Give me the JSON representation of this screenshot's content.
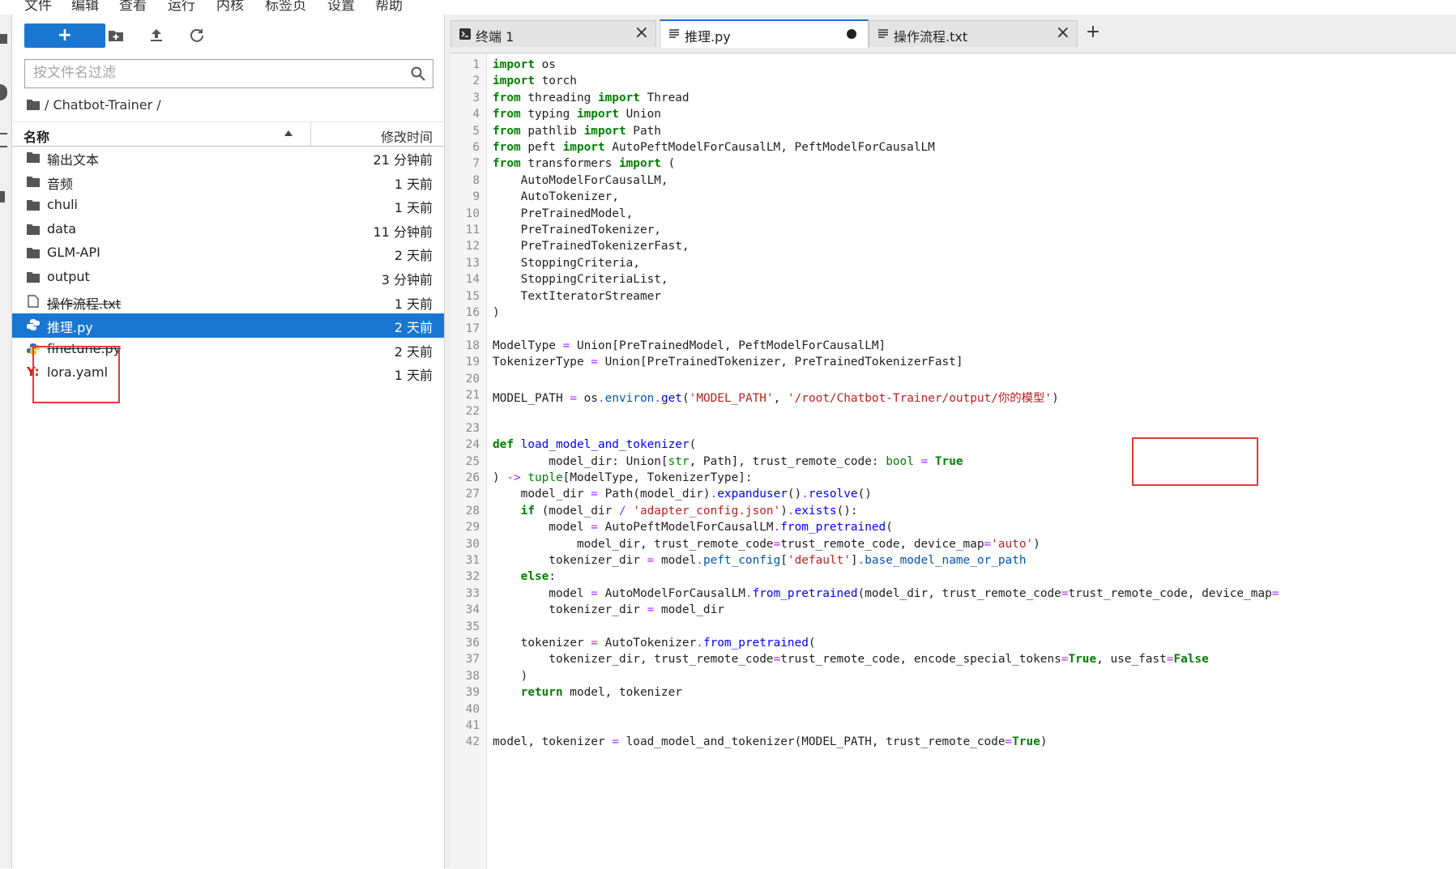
{
  "menu": {
    "items": [
      "文件",
      "编辑",
      "查看",
      "运行",
      "内核",
      "标签页",
      "设置",
      "帮助"
    ]
  },
  "file_browser": {
    "new_button_label": "+",
    "filter_placeholder": "按文件名过滤",
    "breadcrumb": "/ Chatbot-Trainer /",
    "columns": {
      "name": "名称",
      "modified": "修改时间"
    },
    "files": [
      {
        "name": "输出文本",
        "type": "folder",
        "modified": "21 分钟前"
      },
      {
        "name": "音频",
        "type": "folder",
        "modified": "1 天前"
      },
      {
        "name": "chuli",
        "type": "folder",
        "modified": "1 天前"
      },
      {
        "name": "data",
        "type": "folder",
        "modified": "11 分钟前"
      },
      {
        "name": "GLM-API",
        "type": "folder",
        "modified": "2 天前"
      },
      {
        "name": "output",
        "type": "folder",
        "modified": "3 分钟前"
      },
      {
        "name": "操作流程.txt",
        "type": "text",
        "modified": "1 天前"
      },
      {
        "name": "推理.py",
        "type": "python",
        "modified": "2 天前",
        "selected": true
      },
      {
        "name": "finetune.py",
        "type": "python",
        "modified": "2 天前"
      },
      {
        "name": "lora.yaml",
        "type": "yaml",
        "modified": "1 天前"
      }
    ]
  },
  "tabs": [
    {
      "label": "终端 1",
      "icon": "terminal-icon",
      "closable": true
    },
    {
      "label": "推理.py",
      "icon": "file-text-icon",
      "active": true,
      "dirty": true
    },
    {
      "label": "操作流程.txt",
      "icon": "file-text-icon",
      "closable": true
    }
  ],
  "add_tab_label": "+",
  "colors": {
    "accent": "#1976d2",
    "keyword": "#008000",
    "string": "#ba2121",
    "operator": "#aa22ff",
    "function": "#0000ff",
    "annotation_box": "#e53935"
  },
  "code": [
    [
      [
        "kw",
        "import"
      ],
      [
        "t",
        " os"
      ]
    ],
    [
      [
        "kw",
        "import"
      ],
      [
        "t",
        " torch"
      ]
    ],
    [
      [
        "kw",
        "from"
      ],
      [
        "t",
        " threading "
      ],
      [
        "kw",
        "import"
      ],
      [
        "t",
        " Thread"
      ]
    ],
    [
      [
        "kw",
        "from"
      ],
      [
        "t",
        " typing "
      ],
      [
        "kw",
        "import"
      ],
      [
        "t",
        " Union"
      ]
    ],
    [
      [
        "kw",
        "from"
      ],
      [
        "t",
        " pathlib "
      ],
      [
        "kw",
        "import"
      ],
      [
        "t",
        " Path"
      ]
    ],
    [
      [
        "kw",
        "from"
      ],
      [
        "t",
        " peft "
      ],
      [
        "kw",
        "import"
      ],
      [
        "t",
        " AutoPeftModelForCausalLM, PeftModelForCausalLM"
      ]
    ],
    [
      [
        "kw",
        "from"
      ],
      [
        "t",
        " transformers "
      ],
      [
        "kw",
        "import"
      ],
      [
        "t",
        " ("
      ]
    ],
    [
      [
        "t",
        "    AutoModelForCausalLM,"
      ]
    ],
    [
      [
        "t",
        "    AutoTokenizer,"
      ]
    ],
    [
      [
        "t",
        "    PreTrainedModel,"
      ]
    ],
    [
      [
        "t",
        "    PreTrainedTokenizer,"
      ]
    ],
    [
      [
        "t",
        "    PreTrainedTokenizerFast,"
      ]
    ],
    [
      [
        "t",
        "    StoppingCriteria,"
      ]
    ],
    [
      [
        "t",
        "    StoppingCriteriaList,"
      ]
    ],
    [
      [
        "t",
        "    TextIteratorStreamer"
      ]
    ],
    [
      [
        "t",
        ")"
      ]
    ],
    [],
    [
      [
        "t",
        "ModelType "
      ],
      [
        "op",
        "="
      ],
      [
        "t",
        " Union[PreTrainedModel, PeftModelForCausalLM]"
      ]
    ],
    [
      [
        "t",
        "TokenizerType "
      ],
      [
        "op",
        "="
      ],
      [
        "t",
        " Union[PreTrainedTokenizer, PreTrainedTokenizerFast]"
      ]
    ],
    [],
    [
      [
        "t",
        "MODEL_PATH "
      ],
      [
        "op",
        "="
      ],
      [
        "t",
        " os"
      ],
      [
        "op",
        "."
      ],
      [
        "at",
        "environ"
      ],
      [
        "op",
        "."
      ],
      [
        "fn",
        "get"
      ],
      [
        "t",
        "("
      ],
      [
        "st",
        "'MODEL_PATH'"
      ],
      [
        "t",
        ", "
      ],
      [
        "st",
        "'/root/Chatbot-Trainer/output/你的模型'"
      ],
      [
        "t",
        ")"
      ]
    ],
    [],
    [],
    [
      [
        "kw",
        "def"
      ],
      [
        "t",
        " "
      ],
      [
        "fn",
        "load_model_and_tokenizer"
      ],
      [
        "t",
        "("
      ]
    ],
    [
      [
        "t",
        "        model_dir: Union["
      ],
      [
        "bi",
        "str"
      ],
      [
        "t",
        ", Path], trust_remote_code: "
      ],
      [
        "bi",
        "bool"
      ],
      [
        "t",
        " "
      ],
      [
        "op",
        "="
      ],
      [
        "t",
        " "
      ],
      [
        "kw",
        "True"
      ]
    ],
    [
      [
        "t",
        ") "
      ],
      [
        "op",
        "->"
      ],
      [
        "t",
        " "
      ],
      [
        "bi",
        "tuple"
      ],
      [
        "t",
        "[ModelType, TokenizerType]:"
      ]
    ],
    [
      [
        "t",
        "    model_dir "
      ],
      [
        "op",
        "="
      ],
      [
        "t",
        " Path(model_dir)"
      ],
      [
        "op",
        "."
      ],
      [
        "fn",
        "expanduser"
      ],
      [
        "t",
        "()"
      ],
      [
        "op",
        "."
      ],
      [
        "fn",
        "resolve"
      ],
      [
        "t",
        "()"
      ]
    ],
    [
      [
        "t",
        "    "
      ],
      [
        "kw",
        "if"
      ],
      [
        "t",
        " (model_dir "
      ],
      [
        "op",
        "/"
      ],
      [
        "t",
        " "
      ],
      [
        "st",
        "'adapter_config.json'"
      ],
      [
        "t",
        ")"
      ],
      [
        "op",
        "."
      ],
      [
        "fn",
        "exists"
      ],
      [
        "t",
        "():"
      ]
    ],
    [
      [
        "t",
        "        model "
      ],
      [
        "op",
        "="
      ],
      [
        "t",
        " AutoPeftModelForCausalLM"
      ],
      [
        "op",
        "."
      ],
      [
        "fn",
        "from_pretrained"
      ],
      [
        "t",
        "("
      ]
    ],
    [
      [
        "t",
        "            model_dir, trust_remote_code"
      ],
      [
        "op",
        "="
      ],
      [
        "t",
        "trust_remote_code, device_map"
      ],
      [
        "op",
        "="
      ],
      [
        "st",
        "'auto'"
      ],
      [
        "t",
        ")"
      ]
    ],
    [
      [
        "t",
        "        tokenizer_dir "
      ],
      [
        "op",
        "="
      ],
      [
        "t",
        " model"
      ],
      [
        "op",
        "."
      ],
      [
        "at",
        "peft_config"
      ],
      [
        "t",
        "["
      ],
      [
        "st",
        "'default'"
      ],
      [
        "t",
        "]"
      ],
      [
        "op",
        "."
      ],
      [
        "at",
        "base_model_name_or_path"
      ]
    ],
    [
      [
        "t",
        "    "
      ],
      [
        "kw",
        "else"
      ],
      [
        "t",
        ":"
      ]
    ],
    [
      [
        "t",
        "        model "
      ],
      [
        "op",
        "="
      ],
      [
        "t",
        " AutoModelForCausalLM"
      ],
      [
        "op",
        "."
      ],
      [
        "fn",
        "from_pretrained"
      ],
      [
        "t",
        "(model_dir, trust_remote_code"
      ],
      [
        "op",
        "="
      ],
      [
        "t",
        "trust_remote_code, device_map"
      ],
      [
        "op",
        "="
      ]
    ],
    [
      [
        "t",
        "        tokenizer_dir "
      ],
      [
        "op",
        "="
      ],
      [
        "t",
        " model_dir"
      ]
    ],
    [],
    [
      [
        "t",
        "    tokenizer "
      ],
      [
        "op",
        "="
      ],
      [
        "t",
        " AutoTokenizer"
      ],
      [
        "op",
        "."
      ],
      [
        "fn",
        "from_pretrained"
      ],
      [
        "t",
        "("
      ]
    ],
    [
      [
        "t",
        "        tokenizer_dir, trust_remote_code"
      ],
      [
        "op",
        "="
      ],
      [
        "t",
        "trust_remote_code, encode_special_tokens"
      ],
      [
        "op",
        "="
      ],
      [
        "kw",
        "True"
      ],
      [
        "t",
        ", use_fast"
      ],
      [
        "op",
        "="
      ],
      [
        "kw",
        "False"
      ]
    ],
    [
      [
        "t",
        "    )"
      ]
    ],
    [
      [
        "t",
        "    "
      ],
      [
        "kw",
        "return"
      ],
      [
        "t",
        " model, tokenizer"
      ]
    ],
    [],
    [],
    [
      [
        "t",
        "model, tokenizer "
      ],
      [
        "op",
        "="
      ],
      [
        "t",
        " load_model_and_tokenizer(MODEL_PATH, trust_remote_code"
      ],
      [
        "op",
        "="
      ],
      [
        "kw",
        "True"
      ],
      [
        "t",
        ")"
      ]
    ]
  ]
}
